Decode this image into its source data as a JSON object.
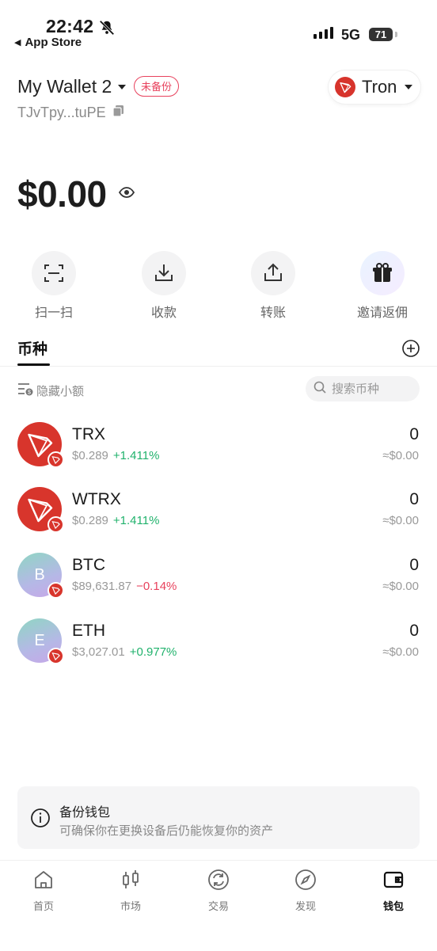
{
  "status_bar": {
    "time": "22:42",
    "back_label": "App Store",
    "network": "5G",
    "battery": "71"
  },
  "header": {
    "wallet_name": "My Wallet 2",
    "backup_badge": "未备份",
    "address": "TJvTpy...tuPE",
    "chain": "Tron"
  },
  "balance": {
    "amount": "$0.00"
  },
  "actions": [
    {
      "label": "扫一扫",
      "icon": "scan-icon"
    },
    {
      "label": "收款",
      "icon": "receive-icon"
    },
    {
      "label": "转账",
      "icon": "send-icon"
    },
    {
      "label": "邀请返佣",
      "icon": "gift-icon"
    }
  ],
  "tabs": {
    "coins": "币种"
  },
  "filters": {
    "hide_small": "隐藏小额",
    "search_placeholder": "搜索币种"
  },
  "tokens": [
    {
      "symbol": "TRX",
      "price": "$0.289",
      "change": "+1.411%",
      "amount": "0",
      "value": "≈$0.00"
    },
    {
      "symbol": "WTRX",
      "price": "$0.289",
      "change": "+1.411%",
      "amount": "0",
      "value": "≈$0.00"
    },
    {
      "symbol": "BTC",
      "letter": "B",
      "price": "$89,631.87",
      "change": "−0.14%",
      "amount": "0",
      "value": "≈$0.00"
    },
    {
      "symbol": "ETH",
      "letter": "E",
      "price": "$3,027.01",
      "change": "+0.977%",
      "amount": "0",
      "value": "≈$0.00"
    }
  ],
  "backup_card": {
    "title": "备份钱包",
    "description": "可确保你在更换设备后仍能恢复你的资产"
  },
  "nav": [
    {
      "label": "首页",
      "icon": "home-icon"
    },
    {
      "label": "市场",
      "icon": "market-icon"
    },
    {
      "label": "交易",
      "icon": "swap-icon"
    },
    {
      "label": "发现",
      "icon": "compass-icon"
    },
    {
      "label": "钱包",
      "icon": "wallet-icon",
      "active": true
    }
  ],
  "colors": {
    "tron_red": "#d8352c",
    "positive": "#20b26c",
    "negative": "#e8425d"
  }
}
